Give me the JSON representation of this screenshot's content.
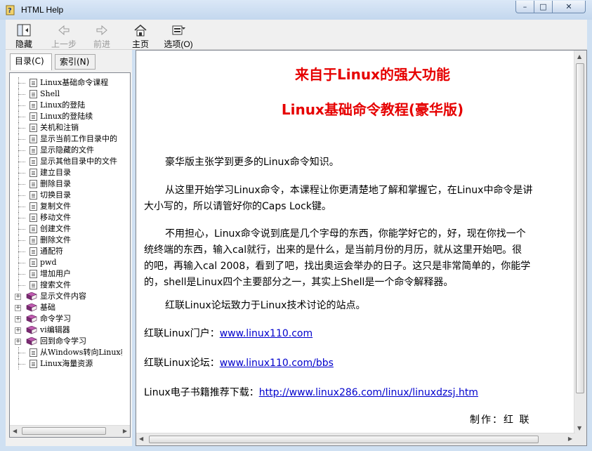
{
  "window": {
    "title": "HTML Help",
    "controls": {
      "minimize": "–",
      "maximize": "□",
      "close": "✕"
    }
  },
  "toolbar": {
    "items": [
      {
        "label": "隐藏",
        "icon": "hide-icon",
        "enabled": true
      },
      {
        "label": "上一步",
        "icon": "back-arrow-icon",
        "enabled": false
      },
      {
        "label": "前进",
        "icon": "forward-arrow-icon",
        "enabled": false
      },
      {
        "label": "主页",
        "icon": "home-icon",
        "enabled": true
      },
      {
        "label": "选项(O)",
        "icon": "options-icon",
        "enabled": true
      }
    ]
  },
  "tabs": [
    {
      "label": "目录(C)",
      "active": true
    },
    {
      "label": "索引(N)",
      "active": false
    }
  ],
  "tree": [
    {
      "label": "Linux基础命令课程",
      "type": "page"
    },
    {
      "label": "Shell",
      "type": "page"
    },
    {
      "label": "Linux的登陆",
      "type": "page"
    },
    {
      "label": "Linux的登陆续",
      "type": "page"
    },
    {
      "label": "关机和注销",
      "type": "page"
    },
    {
      "label": "显示当前工作目录中的",
      "type": "page"
    },
    {
      "label": "显示隐藏的文件",
      "type": "page"
    },
    {
      "label": "显示其他目录中的文件",
      "type": "page"
    },
    {
      "label": "建立目录",
      "type": "page"
    },
    {
      "label": "删除目录",
      "type": "page"
    },
    {
      "label": "切换目录",
      "type": "page"
    },
    {
      "label": "复制文件",
      "type": "page"
    },
    {
      "label": "移动文件",
      "type": "page"
    },
    {
      "label": "创建文件",
      "type": "page"
    },
    {
      "label": "删除文件",
      "type": "page"
    },
    {
      "label": "通配符",
      "type": "page"
    },
    {
      "label": "pwd",
      "type": "page"
    },
    {
      "label": "增加用户",
      "type": "page"
    },
    {
      "label": "搜索文件",
      "type": "page"
    },
    {
      "label": "显示文件内容",
      "type": "book"
    },
    {
      "label": "基础",
      "type": "book"
    },
    {
      "label": "命令学习",
      "type": "book"
    },
    {
      "label": "vi编辑器",
      "type": "book"
    },
    {
      "label": "回到命令学习",
      "type": "book"
    },
    {
      "label": "从Windows转向Linux教",
      "type": "page"
    },
    {
      "label": "Linux海量资源",
      "type": "page"
    }
  ],
  "content": {
    "heading1": "来自于Linux的强大功能",
    "heading2": "Linux基础命令教程(豪华版)",
    "p1": "豪华版主张学到更多的Linux命令知识。",
    "p2_line1": "从这里开始学习Linux命令，本课程让你更清楚地了解和掌握它，在Linux中命令是讲",
    "p2_line2": "大小写的，所以请管好你的Caps Lock键。",
    "p3_line1": "不用担心，Linux命令说到底是几个字母的东西，你能学好它的，好，现在你找一个",
    "p3_line2": "统终端的东西，输入cal就行，出来的是什么，是当前月份的月历，就从这里开始吧。很",
    "p3_line3": "的吧，再输入cal 2008，看到了吧，找出奥运会举办的日子。这只是非常简单的，你能学",
    "p3_line4": "的，shell是Linux四个主要部分之一，其实上Shell是一个命令解释器。",
    "p4": "红联Linux论坛致力于Linux技术讨论的站点。",
    "portal_label": "红联Linux门户：",
    "portal_link": "www.linux110.com",
    "forum_label": "红联Linux论坛：",
    "forum_link": "www.linux110.com/bbs",
    "ebook_label": "Linux电子书籍推荐下载：",
    "ebook_link": "http://www.linux286.com/linux/linuxdzsj.htm",
    "credit": "制作：红  联"
  },
  "colors": {
    "heading": "#e60000",
    "link": "#0000cc",
    "chrome": "#cfe0f2"
  }
}
